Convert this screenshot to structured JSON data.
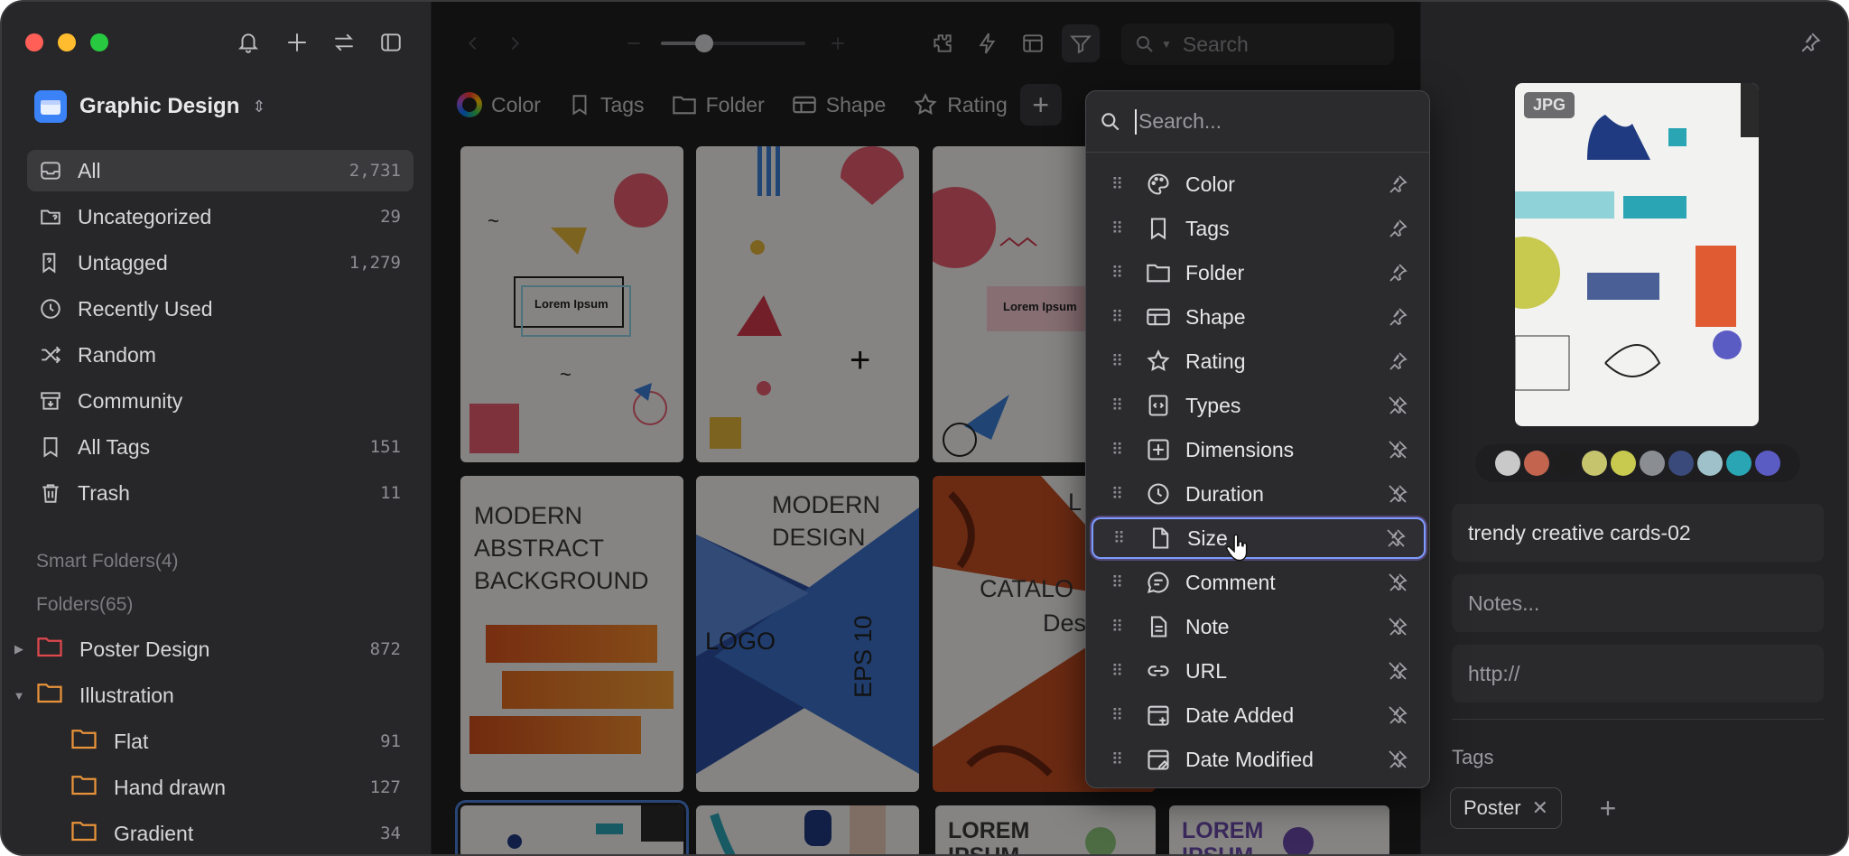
{
  "sidebar": {
    "library": "Graphic Design",
    "nav": [
      {
        "label": "All",
        "count": "2,731",
        "icon": "inbox-icon"
      },
      {
        "label": "Uncategorized",
        "count": "29",
        "icon": "folder-question-icon"
      },
      {
        "label": "Untagged",
        "count": "1,279",
        "icon": "tag-question-icon"
      },
      {
        "label": "Recently Used",
        "count": "",
        "icon": "clock-icon"
      },
      {
        "label": "Random",
        "count": "",
        "icon": "shuffle-icon"
      },
      {
        "label": "Community",
        "count": "",
        "icon": "archive-icon"
      },
      {
        "label": "All Tags",
        "count": "151",
        "icon": "bookmark-icon"
      },
      {
        "label": "Trash",
        "count": "11",
        "icon": "trash-icon"
      }
    ],
    "smart_folders_label": "Smart Folders(4)",
    "folders_label": "Folders(65)",
    "folders": [
      {
        "label": "Poster Design",
        "count": "872"
      },
      {
        "label": "Illustration",
        "count": ""
      },
      {
        "label": "Flat",
        "count": "91"
      },
      {
        "label": "Hand drawn",
        "count": "127"
      },
      {
        "label": "Gradient",
        "count": "34"
      }
    ]
  },
  "toolbar": {
    "search_placeholder": "Search",
    "zoom_level": 0.3,
    "filters": [
      {
        "label": "Color",
        "icon": "color-wheel-icon"
      },
      {
        "label": "Tags",
        "icon": "bookmark-icon"
      },
      {
        "label": "Folder",
        "icon": "folder-icon"
      },
      {
        "label": "Shape",
        "icon": "shape-icon"
      },
      {
        "label": "Rating",
        "icon": "star-icon"
      }
    ],
    "add_filter": "+"
  },
  "grid": {
    "cards": [
      {
        "text": "Lorem Ipsum"
      },
      {
        "text": ""
      },
      {
        "text": "Lorem Ipsum"
      },
      {
        "text": "MODERN ABSTRACT BACKGROUND"
      },
      {
        "text": "MODERN DESIGN",
        "sub": "LOGO",
        "side": "EPS 10"
      },
      {
        "text": "L",
        "sub": "CATALO",
        "sub2": "Des"
      },
      {
        "text": ""
      },
      {
        "text": ""
      },
      {
        "text": "LOREM IPSUM"
      },
      {
        "text": "LOREM IPSUM"
      }
    ]
  },
  "dropdown": {
    "search_placeholder": "Search...",
    "items": [
      {
        "label": "Color",
        "icon": "palette-icon",
        "pinned": true
      },
      {
        "label": "Tags",
        "icon": "bookmark-icon",
        "pinned": true
      },
      {
        "label": "Folder",
        "icon": "folder-icon",
        "pinned": true
      },
      {
        "label": "Shape",
        "icon": "shape-icon",
        "pinned": true
      },
      {
        "label": "Rating",
        "icon": "star-icon",
        "pinned": true
      },
      {
        "label": "Types",
        "icon": "file-code-icon",
        "pinned": false
      },
      {
        "label": "Dimensions",
        "icon": "dimensions-icon",
        "pinned": false
      },
      {
        "label": "Duration",
        "icon": "clock-icon",
        "pinned": false
      },
      {
        "label": "Size",
        "icon": "file-icon",
        "pinned": false
      },
      {
        "label": "Comment",
        "icon": "comment-icon",
        "pinned": false
      },
      {
        "label": "Note",
        "icon": "note-icon",
        "pinned": false
      },
      {
        "label": "URL",
        "icon": "link-icon",
        "pinned": false
      },
      {
        "label": "Date Added",
        "icon": "calendar-plus-icon",
        "pinned": false
      },
      {
        "label": "Date Modified",
        "icon": "calendar-edit-icon",
        "pinned": false
      }
    ],
    "highlighted": "Size"
  },
  "inspector": {
    "badge": "JPG",
    "swatches": [
      "#c9c9c9",
      "#c2644e",
      "#1d1d1d",
      "#c7c46e",
      "#c8c94f",
      "#8a8d91",
      "#3a4a7a",
      "#9fc1c9",
      "#2aa5b4",
      "#5b5bc4"
    ],
    "name": "trendy creative cards-02",
    "notes_placeholder": "Notes...",
    "url_placeholder": "http://",
    "tags_label": "Tags",
    "tags": [
      "Poster"
    ],
    "add_tag": "+"
  }
}
